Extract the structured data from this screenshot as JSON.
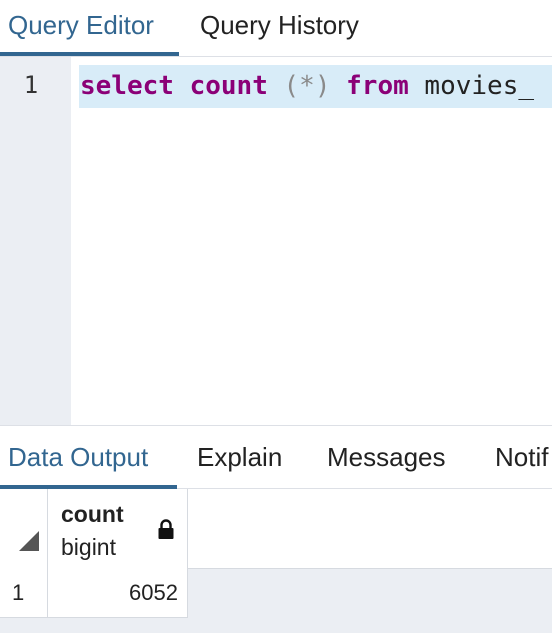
{
  "editor_tabs": [
    {
      "label": "Query Editor",
      "active": true
    },
    {
      "label": "Query History",
      "active": false
    }
  ],
  "editor": {
    "line_number": "1",
    "tokens": {
      "kw_select": "select",
      "fn_count": "count",
      "args": "(*)",
      "kw_from": "from",
      "table": "movies_"
    }
  },
  "output_tabs": [
    {
      "label": "Data Output",
      "active": true
    },
    {
      "label": "Explain",
      "active": false
    },
    {
      "label": "Messages",
      "active": false
    },
    {
      "label": "Notif",
      "active": false
    }
  ],
  "result_grid": {
    "columns": [
      {
        "name": "count",
        "type": "bigint",
        "icon": "lock-icon"
      }
    ],
    "rows": [
      {
        "number": "1",
        "values": [
          "6052"
        ]
      }
    ]
  },
  "colors": {
    "accent": "#326690",
    "keyword": "#8b0077",
    "line_highlight": "#d8ecf8",
    "gutter": "#ebeef3"
  }
}
